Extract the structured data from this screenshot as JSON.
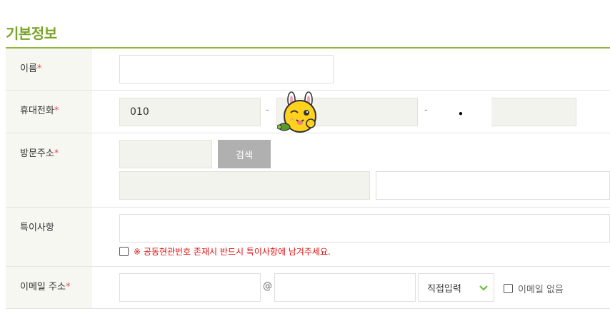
{
  "section": {
    "title": "기본정보"
  },
  "name_row": {
    "label": "이름",
    "required_mark": "*",
    "value": ""
  },
  "phone_row": {
    "label": "휴대전화",
    "required_mark": "*",
    "part1": "010",
    "part2": "",
    "part3": "",
    "separator": "-",
    "masked_char": "•"
  },
  "address_row": {
    "label": "방문주소",
    "required_mark": "*",
    "search_button": "검색",
    "zip": "",
    "address1": "",
    "address2": ""
  },
  "notes_row": {
    "label": "특이사항",
    "value": "",
    "notice": "※ 공동현관번호 존재시 반드시 특이사항에 남겨주세요."
  },
  "email_row": {
    "label": "이메일 주소",
    "required_mark": "*",
    "local": "",
    "at": "@",
    "domain": "",
    "domain_select": "직접입력",
    "no_email_label": "이메일 없음"
  },
  "colors": {
    "accent": "#7aa428",
    "required": "#e05050",
    "notice": "#d11111",
    "chevron": "#6abf3a"
  },
  "icons": {
    "mascot": "rabbit-mascot-icon",
    "select_chevron": "chevron-down-icon"
  }
}
